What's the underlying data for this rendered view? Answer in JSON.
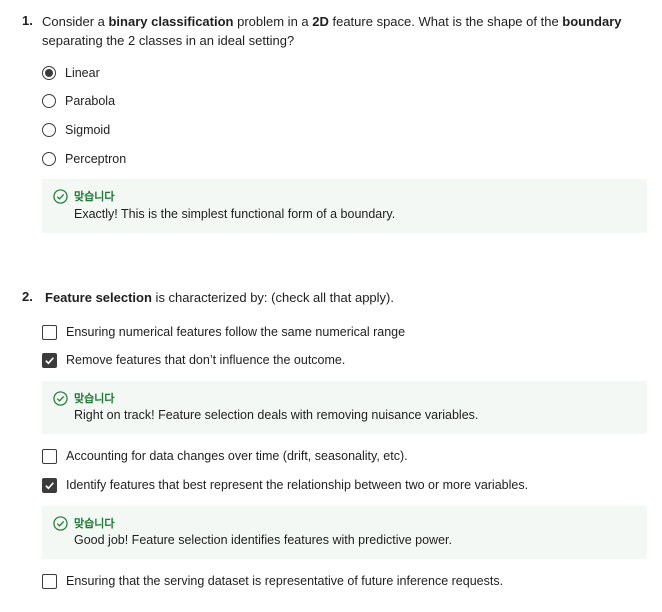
{
  "q1": {
    "number": "1.",
    "text_parts": [
      "Consider a ",
      "binary classification",
      " problem in a ",
      "2D",
      "  feature space. What is the shape of the ",
      "boundary",
      " separating the 2 classes in an ideal setting?"
    ],
    "options": [
      {
        "label": "Linear",
        "selected": true
      },
      {
        "label": "Parabola",
        "selected": false
      },
      {
        "label": "Sigmoid",
        "selected": false
      },
      {
        "label": "Perceptron",
        "selected": false
      }
    ],
    "feedback": {
      "status": "맞습니다",
      "message": "Exactly! This is the simplest functional form of a boundary."
    }
  },
  "q2": {
    "number": "2.",
    "text_bold": "Feature selection",
    "text_rest": " is characterized by: (check all that apply).",
    "options": [
      {
        "label": "Ensuring numerical features follow the same numerical range",
        "checked": false
      },
      {
        "label": "Remove features that don’t influence the outcome.",
        "checked": true,
        "feedback": {
          "status": "맞습니다",
          "message": "Right on track! Feature selection deals with removing nuisance variables."
        }
      },
      {
        "label": "Accounting for data changes over time (drift, seasonality, etc).",
        "checked": false
      },
      {
        "label": "Identify features that best represent the relationship between two or more variables.",
        "checked": true,
        "feedback": {
          "status": "맞습니다",
          "message": "Good job! Feature selection identifies features with predictive power."
        }
      },
      {
        "label": "Ensuring that the serving dataset is representative of future inference requests.",
        "checked": false
      }
    ]
  },
  "colors": {
    "accent": "#1e7a34",
    "feedback_bg": "#f3f8f4",
    "control": "#3b3b3b"
  },
  "icons": {
    "correct": "check-circle-icon",
    "checkmark": "checkmark-icon"
  }
}
